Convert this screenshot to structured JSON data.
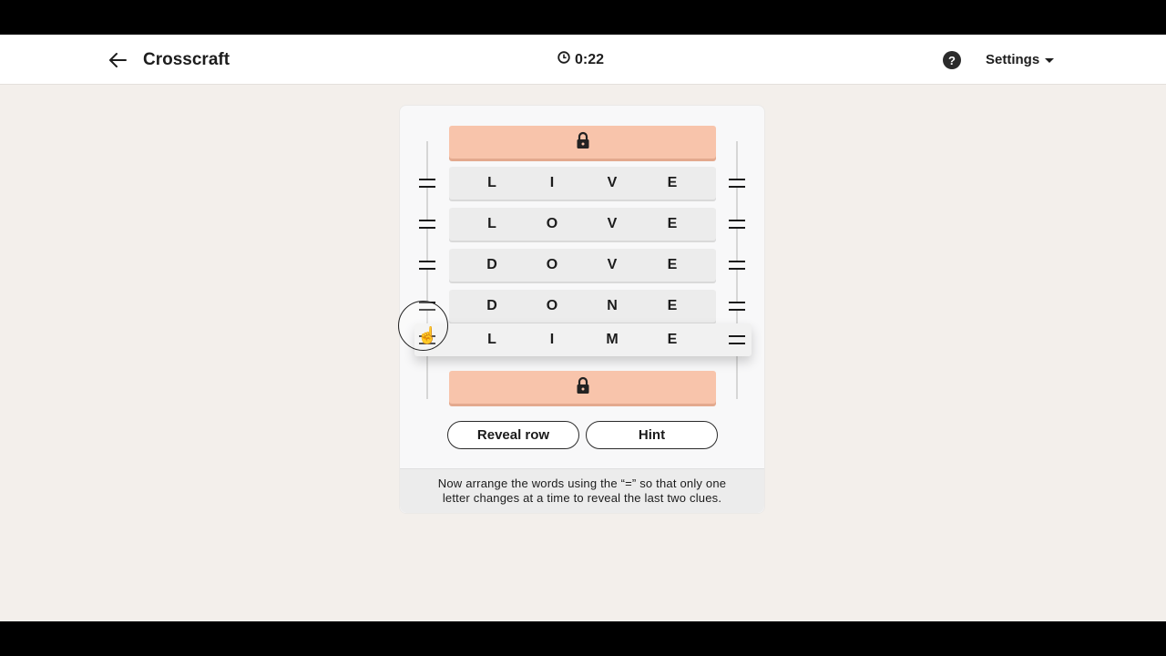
{
  "header": {
    "title": "Crosscraft",
    "timer": "0:22",
    "help_icon": "?",
    "settings_label": "Settings"
  },
  "board": {
    "rows": [
      {
        "id": "top-locked",
        "locked": true,
        "letters": []
      },
      {
        "id": "row-1",
        "locked": false,
        "letters": [
          "L",
          "I",
          "V",
          "E"
        ]
      },
      {
        "id": "row-2",
        "locked": false,
        "letters": [
          "L",
          "O",
          "V",
          "E"
        ]
      },
      {
        "id": "row-3",
        "locked": false,
        "letters": [
          "D",
          "O",
          "V",
          "E"
        ]
      },
      {
        "id": "row-4",
        "locked": false,
        "letters": [
          "D",
          "O",
          "N",
          "E"
        ]
      },
      {
        "id": "row-5-dragging",
        "locked": false,
        "letters": [
          "L",
          "I",
          "M",
          "E"
        ]
      },
      {
        "id": "bottom-locked",
        "locked": true,
        "letters": []
      }
    ],
    "locked_icon": "lock-icon",
    "colors": {
      "locked_row": "#f8c4ab",
      "row": "#ececec"
    }
  },
  "buttons": {
    "reveal_row": "Reveal row",
    "hint": "Hint"
  },
  "instructions": {
    "line1": "Now arrange the words using the “=” so that only one",
    "line2": "letter changes at a time to reveal the last two clues."
  }
}
